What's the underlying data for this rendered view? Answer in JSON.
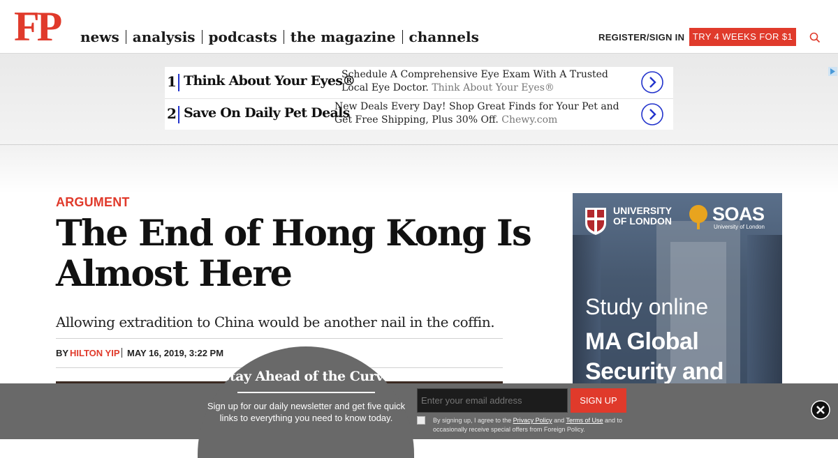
{
  "header": {
    "logo": "FP",
    "nav": [
      "news",
      "analysis",
      "podcasts",
      "the magazine",
      "channels"
    ],
    "register_label": "REGISTER/SIGN IN",
    "subscribe_label": "TRY 4 WEEKS FOR $1",
    "search_icon": "search-icon",
    "accent_color": "#e03a2b"
  },
  "top_ad": {
    "items": [
      {
        "number": "1",
        "title": "Think About Your Eyes®",
        "description": "Schedule A Comprehensive Eye Exam With A Trusted Local Eye Doctor.",
        "domain": "Think About Your Eyes®"
      },
      {
        "number": "2",
        "title": "Save On Daily Pet Deals",
        "description": "New Deals Every Day! Shop Great Finds for Your Pet and Get Free Shipping, Plus 30% Off.",
        "domain": "Chewy.com"
      }
    ]
  },
  "article": {
    "kicker": "ARGUMENT",
    "headline": "The End of Hong Kong Is Almost Here",
    "dek": "Allowing extradition to China would be another nail in the coffin.",
    "by_label": "BY",
    "author": "HILTON YIP",
    "date": "MAY 16, 2019, 3:22 PM"
  },
  "side_ad": {
    "university": "UNIVERSITY OF LONDON",
    "brand": "SOAS",
    "brand_sub": "University of London",
    "line1": "Study online",
    "line2": "MA Global Security and"
  },
  "newsletter": {
    "title": "Stay Ahead of the Curve",
    "text": "Sign up for our daily newsletter and get five quick links to everything you need to know today.",
    "email_placeholder": "Enter your email address",
    "signup_label": "SIGN UP",
    "legal_prefix": "By signing up, I agree to the",
    "privacy_link": "Privacy Policy",
    "and": "and",
    "terms_link": "Terms of Use",
    "legal_suffix": "and to occasionally receive special offers from Foreign Policy."
  }
}
